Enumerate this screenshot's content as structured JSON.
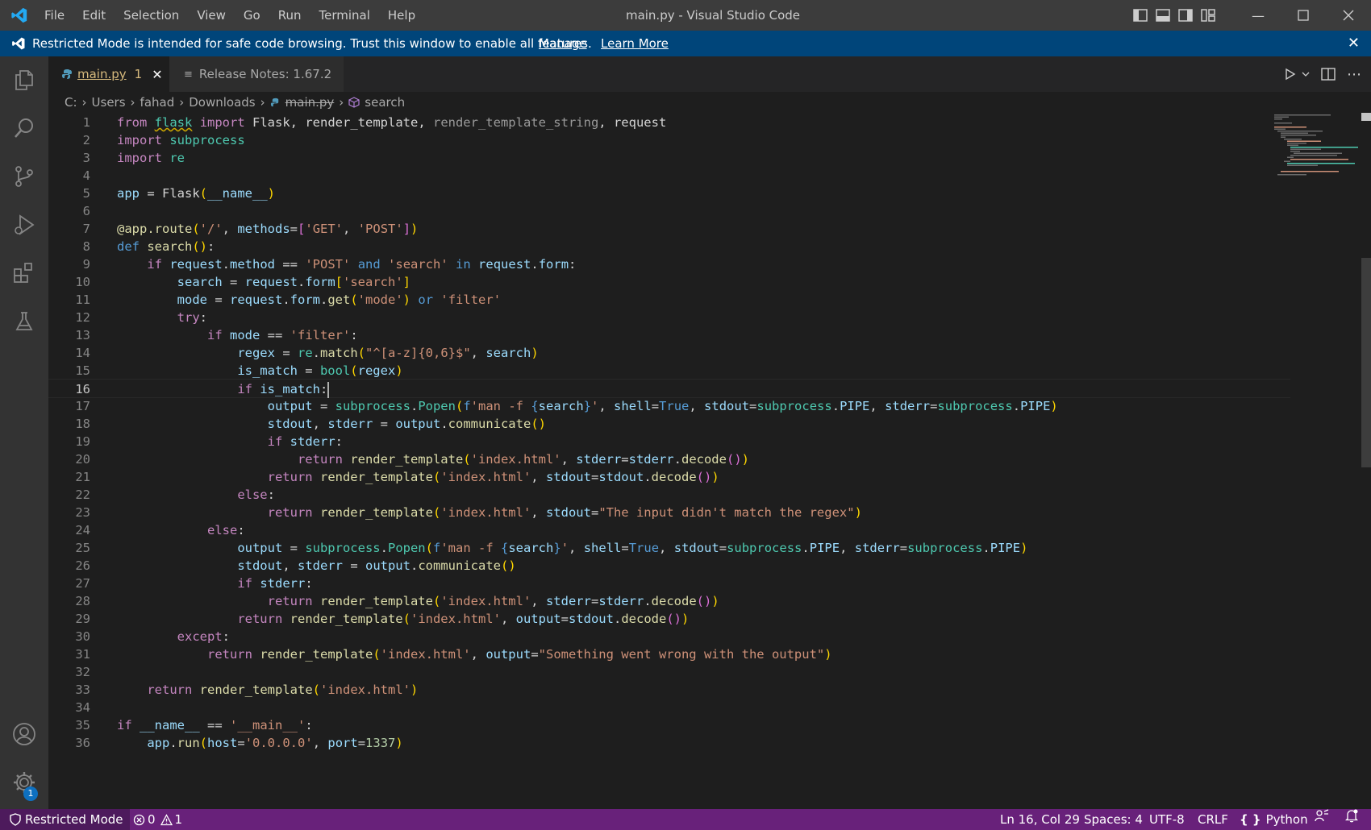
{
  "titlebar": {
    "menu": [
      "File",
      "Edit",
      "Selection",
      "View",
      "Go",
      "Run",
      "Terminal",
      "Help"
    ],
    "title": "main.py - Visual Studio Code"
  },
  "banner": {
    "message": "Restricted Mode is intended for safe code browsing. Trust this window to enable all features.",
    "manage": "Manage",
    "learn_more": "Learn More"
  },
  "activity_icons": [
    "explorer-icon",
    "search-icon",
    "source-control-icon",
    "run-debug-icon",
    "extensions-icon",
    "testing-icon",
    "account-icon",
    "settings-gear-icon"
  ],
  "settings_badge": "1",
  "tabs": [
    {
      "name": "main.py",
      "problems": "1",
      "active": true
    },
    {
      "name": "Release Notes: 1.67.2",
      "active": false
    }
  ],
  "breadcrumb": [
    "C:",
    "Users",
    "fahad",
    "Downloads",
    "main.py",
    "search"
  ],
  "editor": {
    "line_numbers": [
      "1",
      "2",
      "3",
      "4",
      "5",
      "6",
      "7",
      "8",
      "9",
      "10",
      "11",
      "12",
      "13",
      "14",
      "15",
      "16",
      "17",
      "18",
      "19",
      "20",
      "21",
      "22",
      "23",
      "24",
      "25",
      "26",
      "27",
      "28",
      "29",
      "30",
      "31",
      "32",
      "33",
      "34",
      "35",
      "36"
    ],
    "current_line": "16",
    "lines": [
      "from flask import Flask, render_template, render_template_string, request",
      "import subprocess",
      "import re",
      "",
      "app = Flask(__name__)",
      "",
      "@app.route('/', methods=['GET', 'POST'])",
      "def search():",
      "    if request.method == 'POST' and 'search' in request.form:",
      "        search = request.form['search']",
      "        mode = request.form.get('mode') or 'filter'",
      "        try:",
      "            if mode == 'filter':",
      "                regex = re.match(\"^[a-z]{0,6}$\", search)",
      "                is_match = bool(regex)",
      "                if is_match:",
      "                    output = subprocess.Popen(f'man -f {search}', shell=True, stdout=subprocess.PIPE, stderr=subprocess.PIPE)",
      "                    stdout, stderr = output.communicate()",
      "                    if stderr:",
      "                        return render_template('index.html', stderr=stderr.decode())",
      "                    return render_template('index.html', stdout=stdout.decode())",
      "                else:",
      "                    return render_template('index.html', stdout=\"The input didn't match the regex\")",
      "            else:",
      "                output = subprocess.Popen(f'man -f {search}', shell=True, stdout=subprocess.PIPE, stderr=subprocess.PIPE)",
      "                stdout, stderr = output.communicate()",
      "                if stderr:",
      "                    return render_template('index.html', stderr=stderr.decode())",
      "                return render_template('index.html', output=stdout.decode())",
      "        except:",
      "            return render_template('index.html', output=\"Something went wrong with the output\")",
      "",
      "    return render_template('index.html')",
      "",
      "if __name__ == '__main__':",
      "    app.run(host='0.0.0.0', port=1337)"
    ]
  },
  "statusbar": {
    "restricted": "Restricted Mode",
    "errors": "0",
    "warnings": "1",
    "position": "Ln 16, Col 29",
    "spaces": "Spaces: 4",
    "encoding": "UTF-8",
    "eol": "CRLF",
    "language": "Python"
  },
  "colors": {
    "banner": "#00457a",
    "statusbar": "#68217a",
    "activitybar": "#333333",
    "editor_bg": "#1e1e1e"
  }
}
